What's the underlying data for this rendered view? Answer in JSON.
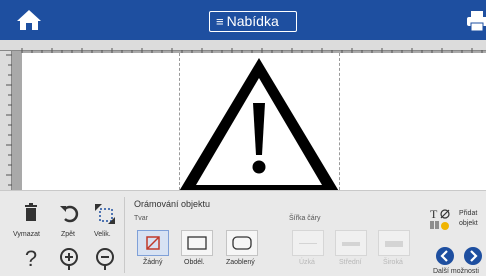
{
  "topbar": {
    "menu_label": "Nabídka",
    "home_icon": "home-icon",
    "print_icon": "printer-icon",
    "color": "#1e4fa0"
  },
  "canvas": {
    "content_icon": "warning-triangle-icon"
  },
  "tools": {
    "delete_label": "Vymazat",
    "undo_label": "Zpět",
    "size_label": "Velik."
  },
  "border_panel": {
    "title": "Orámování objektu",
    "shape_label": "Tvar",
    "shapes": [
      "Žádný",
      "Obdél.",
      "Zaoblený"
    ],
    "selected_shape": "Žádný",
    "line_width_label": "Šířka čáry",
    "widths": [
      "Úzká",
      "Střední",
      "Široká"
    ]
  },
  "right_tools": {
    "add_object_label_line1": "Přidat",
    "add_object_label_line2": "objekt",
    "more_options_label": "Další možnosti"
  }
}
